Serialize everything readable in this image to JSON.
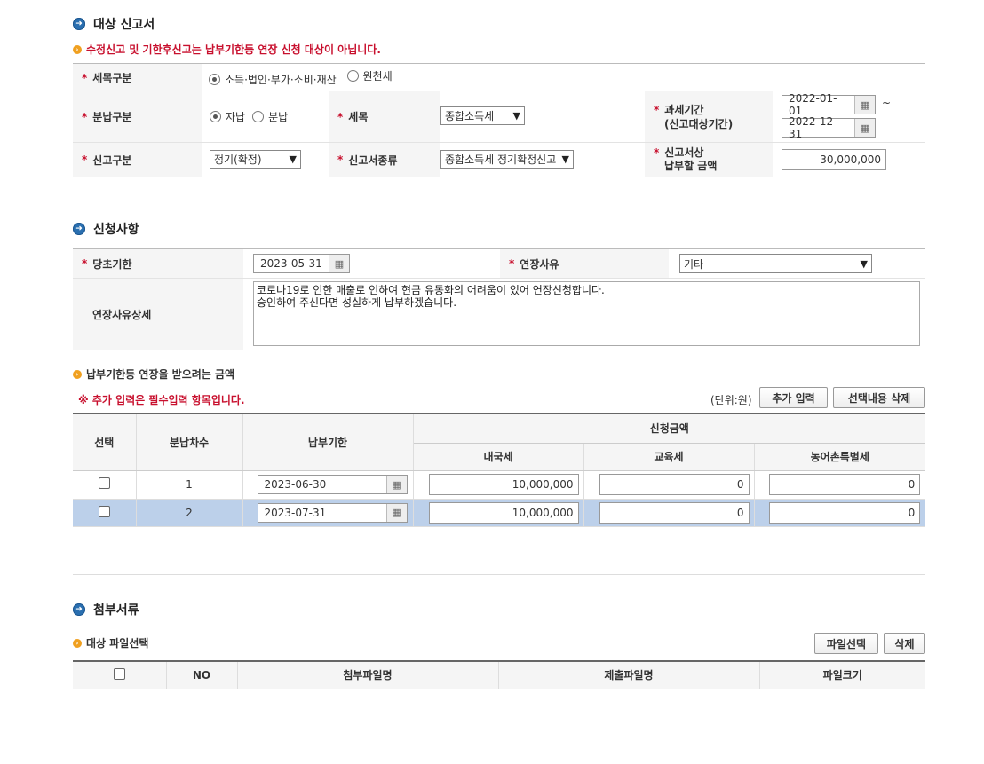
{
  "target_section": {
    "title": "대상 신고서",
    "notice": "수정신고 및 기한후신고는 납부기한등 연장 신청 대상이 아닙니다.",
    "tax_category": {
      "label": "세목구분",
      "options": [
        "소득·법인·부가·소비·재산",
        "원천세"
      ],
      "selected": 0
    },
    "installment_type": {
      "label": "분납구분",
      "options": [
        "자납",
        "분납"
      ],
      "selected": 0
    },
    "tax_item": {
      "label": "세목",
      "value": "종합소득세"
    },
    "tax_period": {
      "label": "과세기간",
      "label2": "(신고대상기간)",
      "start": "2022-01-01",
      "end": "2022-12-31",
      "tilde": "~"
    },
    "report_type": {
      "label": "신고구분",
      "value": "정기(확정)"
    },
    "report_kind": {
      "label": "신고서종류",
      "value": "종합소득세 정기확정신고"
    },
    "payable_amount": {
      "label": "신고서상",
      "label2": "납부할 금액",
      "value": "30,000,000"
    }
  },
  "application_section": {
    "title": "신청사항",
    "original_deadline": {
      "label": "당초기한",
      "value": "2023-05-31"
    },
    "extension_reason": {
      "label": "연장사유",
      "value": "기타"
    },
    "reason_detail": {
      "label": "연장사유상세",
      "line1": "코로나19로 인한 매출로 인하여 현금 유동화의 어려움이 있어 연장신청합니다.",
      "line2": "승인하여 주신다면 성실하게 납부하겠습니다."
    }
  },
  "amount_section": {
    "title": "납부기한등 연장을 받으려는 금액",
    "notice": "※ 추가 입력은 필수입력 항목입니다.",
    "unit": "(단위:원)",
    "add_button": "추가 입력",
    "delete_button": "선택내용 삭제",
    "headers": {
      "select": "선택",
      "installment_no": "분납차수",
      "deadline": "납부기한",
      "amount_group": "신청금액",
      "national_tax": "내국세",
      "education_tax": "교육세",
      "rural_tax": "농어촌특별세"
    },
    "rows": [
      {
        "no": "1",
        "deadline": "2023-06-30",
        "national": "10,000,000",
        "education": "0",
        "rural": "0"
      },
      {
        "no": "2",
        "deadline": "2023-07-31",
        "national": "10,000,000",
        "education": "0",
        "rural": "0"
      }
    ]
  },
  "attachment_section": {
    "title": "첨부서류",
    "subtitle": "대상 파일선택",
    "file_select_button": "파일선택",
    "delete_button": "삭제",
    "headers": {
      "no": "NO",
      "attach_name": "첨부파일명",
      "submit_name": "제출파일명",
      "size": "파일크기"
    }
  },
  "icons": {
    "section_bullet": "arrow-circle-icon",
    "sub_bullet": "arrow-circle-small-icon",
    "calendar": "calendar-icon",
    "dropdown": "chevron-down-icon"
  },
  "colors": {
    "accent_blue": "#2a6fb0",
    "notice_red": "#c8102e",
    "sub_bullet_orange": "#f0a020",
    "highlight_row": "#bcd0ea"
  }
}
